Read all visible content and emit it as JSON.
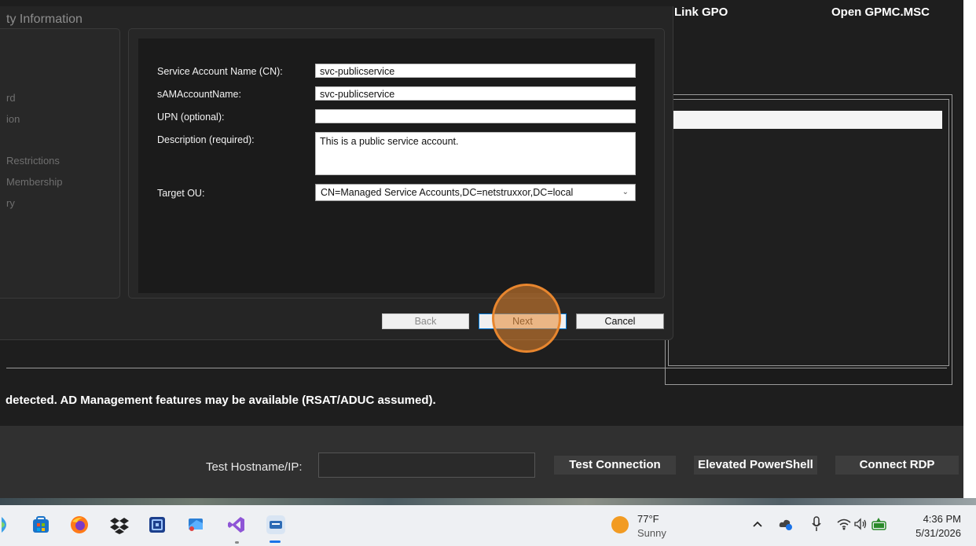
{
  "app": {
    "link_gpo": "Link GPO",
    "open_gpmc": "Open GPMC.MSC",
    "status_text": "detected. AD Management features may be available (RSAT/ADUC assumed).",
    "test_hostname_label": "Test Hostname/IP:",
    "test_hostname_value": "",
    "test_connection": "Test Connection",
    "elevated_powershell": "Elevated PowerShell",
    "connect_rdp": "Connect RDP"
  },
  "dialog": {
    "title": "ty Information",
    "steps": [
      "rd",
      "ion",
      "Restrictions",
      "Membership",
      "ry"
    ],
    "fields": {
      "service_account_name_label": "Service Account Name (CN):",
      "service_account_name_value": "svc-publicservice",
      "sam_label": "sAMAccountName:",
      "sam_value": "svc-publicservice",
      "upn_label": "UPN (optional):",
      "upn_value": "",
      "description_label": "Description (required):",
      "description_value": "This is a public service account.",
      "target_ou_label": "Target OU:",
      "target_ou_value": "CN=Managed Service Accounts,DC=netstruxxor,DC=local"
    },
    "buttons": {
      "back": "Back",
      "next": "Next",
      "cancel": "Cancel"
    }
  },
  "taskbar": {
    "icons": [
      "copilot-icon",
      "microsoft-store-icon",
      "firefox-icon",
      "dropbox-icon",
      "terminal-icon",
      "remote-desktop-icon",
      "visual-studio-icon",
      "app-icon"
    ],
    "weather_temp": "77°F",
    "weather_desc": "Sunny",
    "time": "4:36 PM",
    "date": "5/31/2026"
  },
  "colors": {
    "accent": "#0078d7",
    "click_highlight": "#e8862e"
  }
}
